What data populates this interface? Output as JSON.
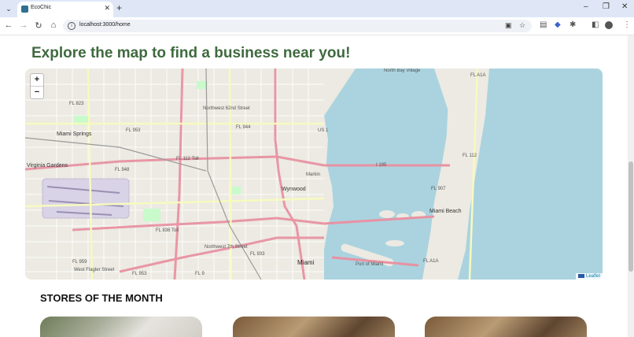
{
  "browser": {
    "tab_title": "EcoChic",
    "url": "localhost:3000/home",
    "new_tab_symbol": "+",
    "tab_close_symbol": "✕",
    "minimize_symbol": "–",
    "restore_symbol": "❐",
    "close_symbol": "✕"
  },
  "page": {
    "map_heading": "Explore the map to find a business near you!",
    "stores_heading": "STORES OF THE MONTH"
  },
  "map": {
    "zoom_in": "+",
    "zoom_out": "−",
    "attribution": "Leaflet",
    "labels": {
      "north_bay_village": "North Bay Village",
      "a1a_top": "FL A1A",
      "fl823": "FL 823",
      "nw62": "Northwest 62nd Street",
      "fl944": "FL 944",
      "us1": "US 1",
      "miami_springs": "Miami Springs",
      "fl953_top": "FL 953",
      "virginia_gardens": "Virginia Gardens",
      "fl948": "FL 948",
      "fl112_toll": "FL 112 Toll",
      "i195": "I 195",
      "fl112": "FL 112",
      "fl907": "FL 907",
      "markin": "Markin",
      "wynwood": "Wynwood",
      "miami_beach": "Miami Beach",
      "fl836_toll": "FL 836 Toll",
      "nw7": "Northwest 7th Street",
      "fl933": "FL 933",
      "fl959": "FL 959",
      "w_flagler": "West Flagler Street",
      "fl953_bottom": "FL 953",
      "fl9": "FL 9",
      "miami": "Miami",
      "a1a_bottom": "FL A1A",
      "port_of_miami": "Port of Miami"
    }
  },
  "colors": {
    "heading_green": "#3f6a3f",
    "water": "#aad3df",
    "land": "#eceae2",
    "highway": "#e892a2",
    "major_road": "#f7fabf",
    "park": "#c8facc"
  },
  "stores": [
    {
      "image": "store-photo-interior"
    },
    {
      "image": "store-photo-brick-shop"
    },
    {
      "image": "store-photo-brick-shop"
    }
  ]
}
